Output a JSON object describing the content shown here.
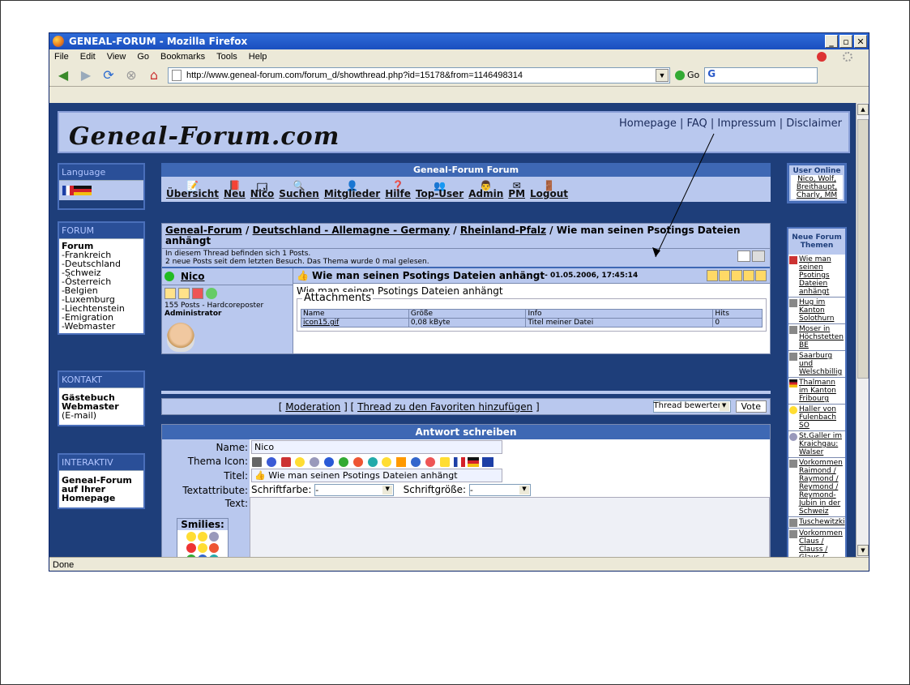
{
  "window": {
    "title": "GENEAL-FORUM - Mozilla Firefox"
  },
  "menu": [
    "File",
    "Edit",
    "View",
    "Go",
    "Bookmarks",
    "Tools",
    "Help"
  ],
  "url": "http://www.geneal-forum.com/forum_d/showthread.php?id=15178&from=1146498314",
  "go_label": "Go",
  "search_text": "G",
  "status": "Done",
  "site": {
    "logo": "Geneal-Forum.com",
    "toplinks": "Homepage | FAQ | Impressum | Disclaimer"
  },
  "left": {
    "language_title": "Language",
    "forum_title": "FORUM",
    "forum_head": "Forum",
    "forum_items": [
      "-Frankreich",
      "-Deutschland",
      "-Schweiz",
      "-Österreich",
      "-Belgien",
      "-Luxemburg",
      "-Liechtenstein",
      "-Emigration",
      "-Webmaster"
    ],
    "kontakt_title": "KONTAKT",
    "kontakt_lines": [
      "Gästebuch",
      "Webmaster",
      "(E-mail)"
    ],
    "interaktiv_title": "INTERAKTIV",
    "interaktiv_text": "Geneal-Forum auf Ihrer Homepage"
  },
  "forum_header": "Geneal-Forum Forum",
  "nav": [
    "Übersicht",
    "Neu",
    "Nico",
    "Suchen",
    "Mitglieder",
    "Hilfe",
    "Top-User",
    "Admin",
    "PM",
    "Logout"
  ],
  "breadcrumb": {
    "parts": [
      "Geneal-Forum",
      "Deutschland - Allemagne - Germany",
      "Rheinland-Pfalz"
    ],
    "current": "Wie man seinen Psotings Dateien anhängt",
    "sep": " / "
  },
  "thread_info": [
    "In diesem Thread befinden sich 1 Posts.",
    "2 neue Posts seit dem letzten Besuch. Das Thema wurde 0 mal gelesen."
  ],
  "post": {
    "author": "Nico",
    "posts": "155 Posts - Hardcoreposter",
    "role": "Administrator",
    "title": "Wie man seinen Psotings Dateien anhängt",
    "date": " - 01.05.2006, 17:45:14",
    "body": "Wie man seinen Psotings Dateien anhängt",
    "attachments_label": "Attachments",
    "att_headers": [
      "Name",
      "Größe",
      "Info",
      "Hits"
    ],
    "att_rows": [
      [
        "icon15.gif",
        "0,08 kByte",
        "Titel meiner Datei",
        "0"
      ]
    ]
  },
  "mod_bar": {
    "left_bracket": "[ ",
    "moderation": "Moderation",
    "mid": " ] [ ",
    "fav": "Thread zu den Favoriten hinzufügen",
    "right_bracket": " ]",
    "rate_select": "Thread bewerten:",
    "vote": "Vote"
  },
  "reply": {
    "header": "Antwort schreiben",
    "name_label": "Name:",
    "name_value": "Nico",
    "icon_label": "Thema Icon:",
    "title_label": "Titel:",
    "title_value": "Wie man seinen Psotings Dateien anhängt",
    "attr_label": "Textattribute:",
    "color_label": "Schriftfarbe:",
    "color_value": "-",
    "size_label": "Schriftgröße:",
    "size_value": "-",
    "text_label": "Text:",
    "smilies_label": "Smilies:"
  },
  "right": {
    "online_title": "User Online",
    "online_users": "Nico, Wolf, Breithaupt, Charly, MM",
    "new_title": "Neue Forum Themen",
    "topics": [
      "Wie man seinen Psotings Dateien anhängt",
      "Hug im Kanton Solothurn",
      "Moser in Höchstetten BE",
      "Saarburg und Welschbillig",
      "Thalmann im Kanton Fribourg",
      "Haller von Fulenbach SO",
      "St.Galler im Kraichgau: Walser",
      "Vorkommen Raimond / Raymond / Reymond / Reymond-Jubin in der Schweiz",
      "Tuschewitzki",
      "Vorkommen Claus / Clauss / Glaus / Klaus / Klauss in der Schweiz"
    ]
  },
  "colors": {
    "page_bg": "#1e3e7a",
    "panel": "#b9c8ee",
    "bar": "#3e68b4",
    "titlebar": "#1a4fbf"
  }
}
